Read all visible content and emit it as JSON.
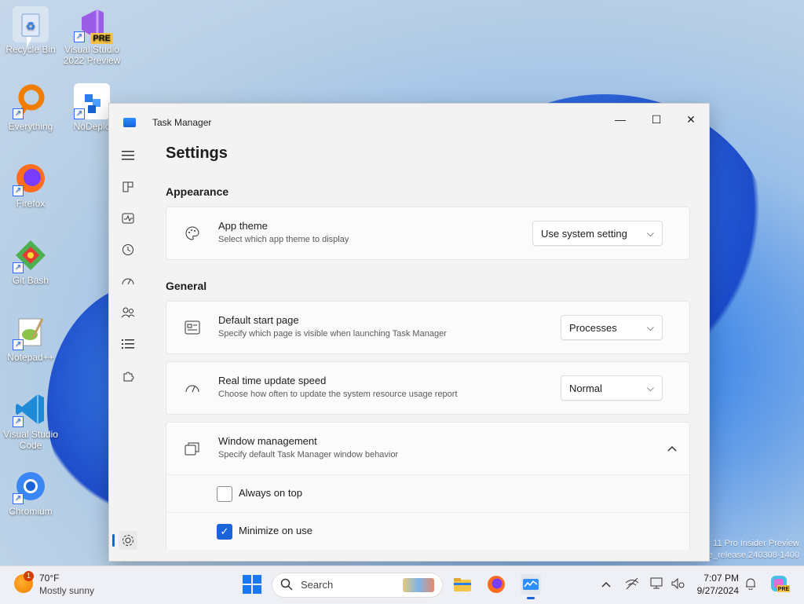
{
  "desktop": {
    "icons": [
      {
        "label": "Recycle Bin",
        "icon": "recycle-bin-icon"
      },
      {
        "label": "Visual Studio 2022 Preview",
        "icon": "visual-studio-icon",
        "badge": "PRE"
      },
      {
        "label": "Everything",
        "icon": "everything-search-icon"
      },
      {
        "label": "NoDeplo",
        "icon": "nodeploy-icon"
      },
      {
        "label": "Firefox",
        "icon": "firefox-icon"
      },
      {
        "label": "Git Bash",
        "icon": "git-bash-icon"
      },
      {
        "label": "Notepad++",
        "icon": "notepadpp-icon"
      },
      {
        "label": "Visual Studio Code",
        "icon": "vscode-icon"
      },
      {
        "label": "Chromium",
        "icon": "chromium-icon"
      }
    ],
    "watermark_line1": "11 Pro Insider Preview",
    "watermark_line2": "e_release.240308-1400"
  },
  "window": {
    "title": "Task Manager",
    "controls": {
      "minimize": "—",
      "maximize": "☐",
      "close": "✕"
    }
  },
  "sidebar": {
    "items": [
      {
        "name": "menu",
        "icon": "hamburger-icon"
      },
      {
        "name": "processes",
        "icon": "processes-icon"
      },
      {
        "name": "performance",
        "icon": "performance-icon"
      },
      {
        "name": "app-history",
        "icon": "history-icon"
      },
      {
        "name": "startup-apps",
        "icon": "startup-speedometer-icon"
      },
      {
        "name": "users",
        "icon": "users-icon"
      },
      {
        "name": "details",
        "icon": "details-list-icon"
      },
      {
        "name": "services",
        "icon": "services-puzzle-icon"
      },
      {
        "name": "settings",
        "icon": "gear-icon"
      }
    ]
  },
  "settings": {
    "page_title": "Settings",
    "appearance": {
      "section_label": "Appearance",
      "app_theme": {
        "title": "App theme",
        "subtitle": "Select which app theme to display",
        "value": "Use system setting"
      }
    },
    "general": {
      "section_label": "General",
      "default_start_page": {
        "title": "Default start page",
        "subtitle": "Specify which page is visible when launching Task Manager",
        "value": "Processes"
      },
      "update_speed": {
        "title": "Real time update speed",
        "subtitle": "Choose how often to update the system resource usage report",
        "value": "Normal"
      },
      "window_management": {
        "title": "Window management",
        "subtitle": "Specify default Task Manager window behavior",
        "always_on_top": {
          "label": "Always on top",
          "checked": false
        },
        "minimize_on_use": {
          "label": "Minimize on use",
          "checked": true
        }
      }
    }
  },
  "taskbar": {
    "weather": {
      "temp": "70°F",
      "condition": "Mostly sunny",
      "badge": "1"
    },
    "search_placeholder": "Search",
    "time": "7:07 PM",
    "date": "9/27/2024"
  }
}
